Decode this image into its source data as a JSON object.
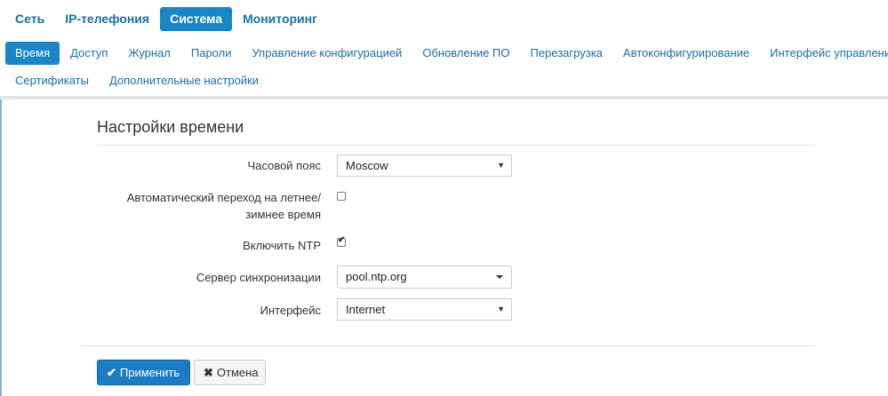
{
  "top_nav": {
    "items": [
      {
        "label": "Сеть"
      },
      {
        "label": "IP-телефония"
      },
      {
        "label": "Система"
      },
      {
        "label": "Мониторинг"
      }
    ],
    "active": "Система"
  },
  "sub_nav": {
    "row1": [
      {
        "label": "Время"
      },
      {
        "label": "Доступ"
      },
      {
        "label": "Журнал"
      },
      {
        "label": "Пароли"
      },
      {
        "label": "Управление конфигурацией"
      },
      {
        "label": "Обновление ПО"
      },
      {
        "label": "Перезагрузка"
      },
      {
        "label": "Автоконфигурирование"
      },
      {
        "label": "Интерфейс управления"
      }
    ],
    "row2": [
      {
        "label": "Сертификаты"
      },
      {
        "label": "Дополнительные настройки"
      }
    ],
    "active": "Время"
  },
  "section": {
    "title": "Настройки времени"
  },
  "form": {
    "timezone_label": "Часовой пояс",
    "timezone_value": "Moscow",
    "dst_label_line1": "Автоматический переход на летнее/",
    "dst_label_line2": "зимнее время",
    "dst_checked": false,
    "ntp_label": "Включить NTP",
    "ntp_checked": true,
    "server_label": "Сервер синхронизации",
    "server_value": "pool.ntp.org",
    "interface_label": "Интерфейс",
    "interface_value": "Internet"
  },
  "buttons": {
    "apply_label": "Применить",
    "cancel_label": "Отмена"
  },
  "colors": {
    "accent": "#1a86c7",
    "link": "#1a6fa8",
    "primary_button": "#1a7dc4"
  },
  "icons": {
    "apply": "check-icon",
    "cancel": "close-icon",
    "select": "triangle-down-icon",
    "combo": "caret-down-icon"
  }
}
